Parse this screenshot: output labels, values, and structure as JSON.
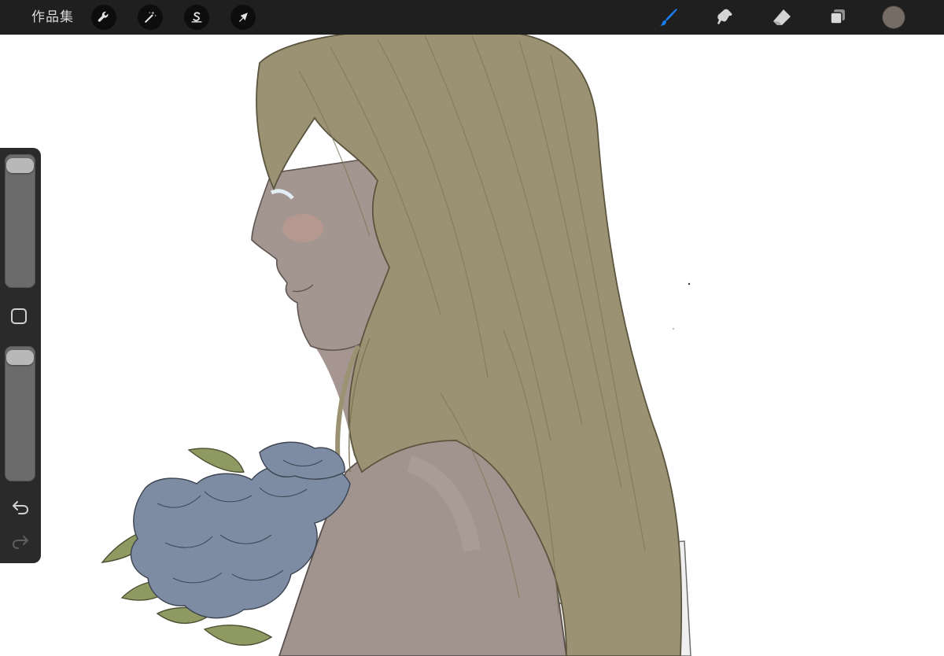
{
  "toolbar": {
    "gallery_label": "作品集",
    "left_tools": [
      {
        "name": "adjustments",
        "icon": "wrench-icon"
      },
      {
        "name": "modify",
        "icon": "magic-wand-icon"
      },
      {
        "name": "selection",
        "icon": "selection-s-icon"
      },
      {
        "name": "transform",
        "icon": "arrow-cursor-icon"
      }
    ],
    "right_tools": [
      {
        "name": "brush",
        "icon": "brush-icon",
        "active": true
      },
      {
        "name": "smudge",
        "icon": "smudge-icon",
        "active": false
      },
      {
        "name": "eraser",
        "icon": "eraser-icon",
        "active": false
      },
      {
        "name": "layers",
        "icon": "layers-icon",
        "active": false
      }
    ],
    "current_color": "#776b66",
    "active_color": "#1a7cf0"
  },
  "sidebar": {
    "brush_size_level": 0.02,
    "opacity_level": 0.02,
    "modify_icon": "square-icon",
    "undo_icon": "undo-icon",
    "redo_icon": "redo-icon"
  },
  "canvas": {
    "description_icon": "artwork-canvas",
    "colors": {
      "hair": "#9b9273",
      "skin": "#9f908a",
      "flowers": "#7d8ba3",
      "leaves": "#8f9a62",
      "dress": "#e9e9e9"
    }
  }
}
